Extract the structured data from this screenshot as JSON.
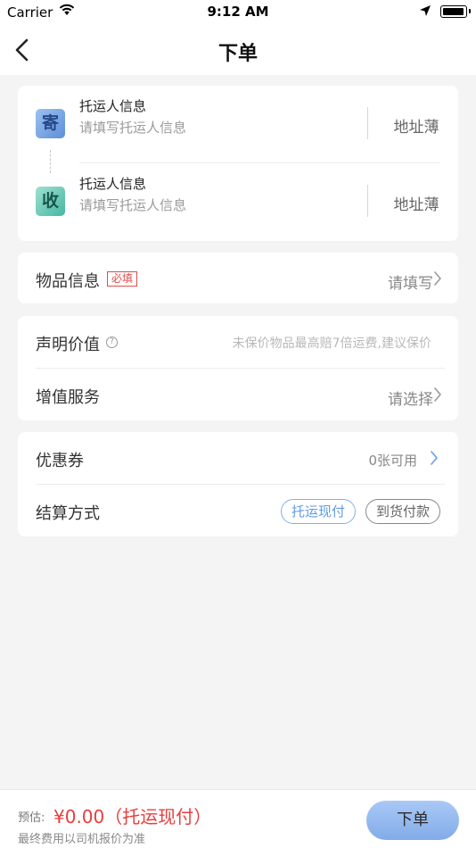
{
  "status_bar": {
    "carrier": "Carrier",
    "time": "9:12 AM",
    "icons": [
      "wifi-icon",
      "location-arrow-icon",
      "battery-icon"
    ]
  },
  "nav": {
    "back_icon": "chevron-left-icon",
    "title": "下单"
  },
  "address": {
    "sender": {
      "badge": "寄",
      "title": "托运人信息",
      "hint": "请填写托运人信息",
      "book": "地址薄"
    },
    "receiver": {
      "badge": "收",
      "title": "托运人信息",
      "hint": "请填写托运人信息",
      "book": "地址薄"
    }
  },
  "item_info": {
    "label": "物品信息",
    "required": "必填",
    "action": "请填写"
  },
  "declared_value": {
    "label": "声明价值",
    "help_icon": "question-circle-icon",
    "hint": "未保价物品最高赔7倍运费,建议保价"
  },
  "value_added": {
    "label": "增值服务",
    "action": "请选择"
  },
  "coupon": {
    "label": "优惠券",
    "value": "0张可用"
  },
  "payment": {
    "label": "结算方式",
    "options": [
      "托运现付",
      "到货付款"
    ],
    "selected": "托运现付"
  },
  "footer": {
    "estimate_label": "预估:",
    "estimate_price": "¥0.00（托运现付）",
    "note": "最终费用以司机报价为准",
    "order_button": "下单"
  },
  "colors": {
    "accent": "#5f9be6",
    "price": "#e83d3d",
    "required": "#e34b4b"
  }
}
